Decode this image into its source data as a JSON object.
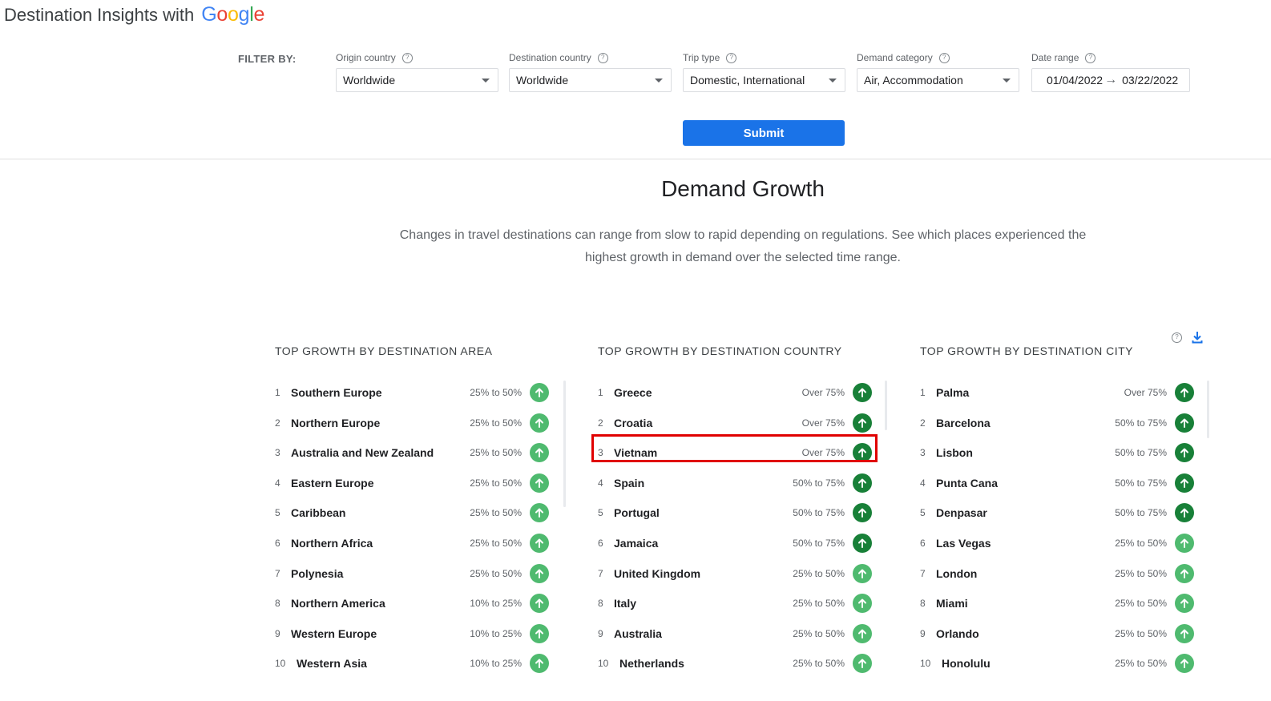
{
  "brand": {
    "prefix": "Destination Insights with",
    "google_letters": [
      "G",
      "o",
      "o",
      "g",
      "l",
      "e"
    ]
  },
  "filters": {
    "label": "FILTER BY:",
    "origin": {
      "label": "Origin country",
      "value": "Worldwide"
    },
    "destination": {
      "label": "Destination country",
      "value": "Worldwide"
    },
    "trip_type": {
      "label": "Trip type",
      "value": "Domestic, International"
    },
    "demand_category": {
      "label": "Demand category",
      "value": "Air, Accommodation"
    },
    "date_range": {
      "label": "Date range",
      "start": "01/04/2022",
      "end": "03/22/2022"
    },
    "submit_label": "Submit"
  },
  "section": {
    "title": "Demand Growth",
    "description": "Changes in travel destinations can range from slow to rapid depending on regulations. See which places experienced the highest growth in demand over the selected time range."
  },
  "colors": {
    "dark_green": "#188038",
    "light_green": "#4fba6f",
    "highlight": "#e00000",
    "primary": "#1a73e8"
  },
  "columns": [
    {
      "title": "TOP GROWTH BY DESTINATION AREA",
      "rows": [
        {
          "rank": "1",
          "name": "Southern Europe",
          "range": "25% to 50%"
        },
        {
          "rank": "2",
          "name": "Northern Europe",
          "range": "25% to 50%"
        },
        {
          "rank": "3",
          "name": "Australia and New Zealand",
          "range": "25% to 50%"
        },
        {
          "rank": "4",
          "name": "Eastern Europe",
          "range": "25% to 50%"
        },
        {
          "rank": "5",
          "name": "Caribbean",
          "range": "25% to 50%"
        },
        {
          "rank": "6",
          "name": "Northern Africa",
          "range": "25% to 50%"
        },
        {
          "rank": "7",
          "name": "Polynesia",
          "range": "25% to 50%"
        },
        {
          "rank": "8",
          "name": "Northern America",
          "range": "10% to 25%"
        },
        {
          "rank": "9",
          "name": "Western Europe",
          "range": "10% to 25%"
        },
        {
          "rank": "10",
          "name": "Western Asia",
          "range": "10% to 25%"
        }
      ]
    },
    {
      "title": "TOP GROWTH BY DESTINATION COUNTRY",
      "rows": [
        {
          "rank": "1",
          "name": "Greece",
          "range": "Over 75%"
        },
        {
          "rank": "2",
          "name": "Croatia",
          "range": "Over 75%"
        },
        {
          "rank": "3",
          "name": "Vietnam",
          "range": "Over 75%"
        },
        {
          "rank": "4",
          "name": "Spain",
          "range": "50% to 75%"
        },
        {
          "rank": "5",
          "name": "Portugal",
          "range": "50% to 75%"
        },
        {
          "rank": "6",
          "name": "Jamaica",
          "range": "50% to 75%"
        },
        {
          "rank": "7",
          "name": "United Kingdom",
          "range": "25% to 50%"
        },
        {
          "rank": "8",
          "name": "Italy",
          "range": "25% to 50%"
        },
        {
          "rank": "9",
          "name": "Australia",
          "range": "25% to 50%"
        },
        {
          "rank": "10",
          "name": "Netherlands",
          "range": "25% to 50%"
        }
      ]
    },
    {
      "title": "TOP GROWTH BY DESTINATION CITY",
      "rows": [
        {
          "rank": "1",
          "name": "Palma",
          "range": "Over 75%"
        },
        {
          "rank": "2",
          "name": "Barcelona",
          "range": "50% to 75%"
        },
        {
          "rank": "3",
          "name": "Lisbon",
          "range": "50% to 75%"
        },
        {
          "rank": "4",
          "name": "Punta Cana",
          "range": "50% to 75%"
        },
        {
          "rank": "5",
          "name": "Denpasar",
          "range": "50% to 75%"
        },
        {
          "rank": "6",
          "name": "Las Vegas",
          "range": "25% to 50%"
        },
        {
          "rank": "7",
          "name": "London",
          "range": "25% to 50%"
        },
        {
          "rank": "8",
          "name": "Miami",
          "range": "25% to 50%"
        },
        {
          "rank": "9",
          "name": "Orlando",
          "range": "25% to 50%"
        },
        {
          "rank": "10",
          "name": "Honolulu",
          "range": "25% to 50%"
        }
      ]
    }
  ]
}
